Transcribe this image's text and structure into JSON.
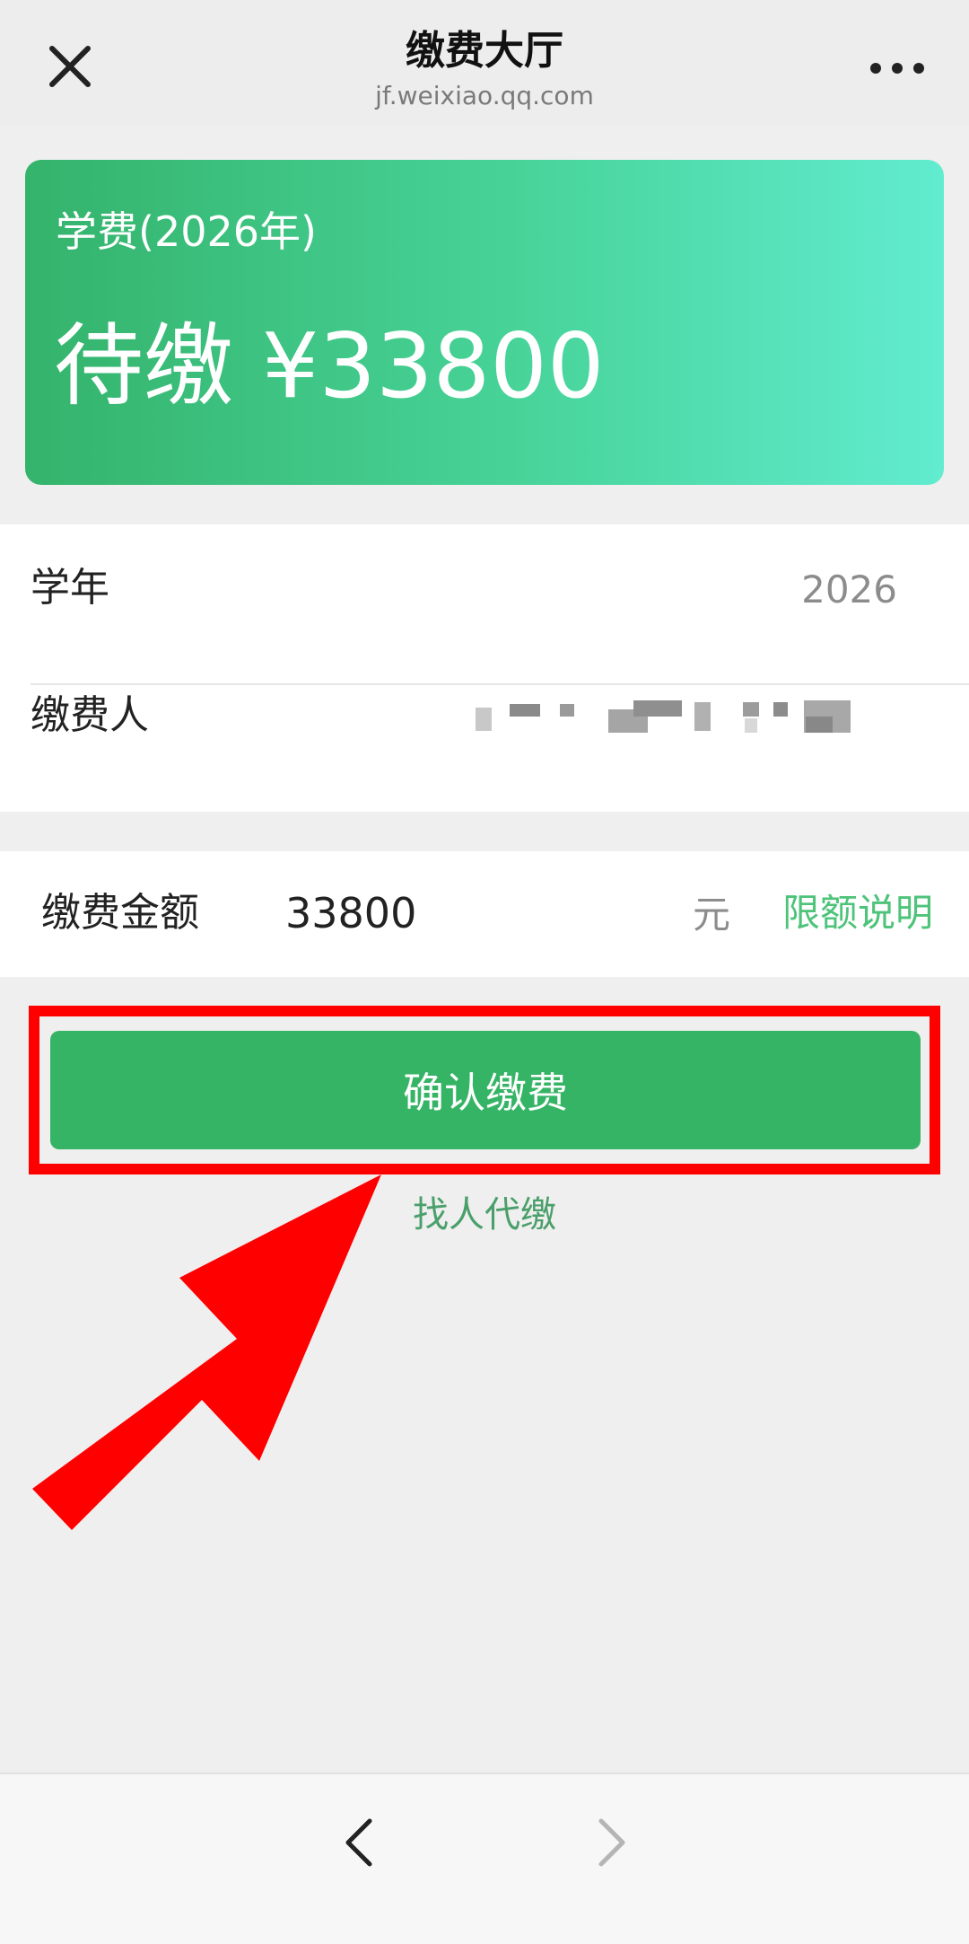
{
  "header": {
    "title": "缴费大厅",
    "url": "jf.weixiao.qq.com"
  },
  "fee_card": {
    "title": "学费(2026年)",
    "pending": "待缴 ¥33800"
  },
  "info": {
    "year_label": "学年",
    "year_value": "2026",
    "payer_label": "缴费人"
  },
  "amount": {
    "label": "缴费金额",
    "value": "33800",
    "unit": "元",
    "limit_link": "限额说明"
  },
  "actions": {
    "confirm_label": "确认缴费",
    "proxy_label": "找人代缴"
  },
  "colors": {
    "accent": "#36b466",
    "highlight": "#ff0000",
    "link": "#4ec37a"
  },
  "icons": {
    "close": "close-icon",
    "more": "more-icon",
    "back": "chevron-left-icon",
    "forward": "chevron-right-icon",
    "annotation": "red-arrow-icon"
  }
}
